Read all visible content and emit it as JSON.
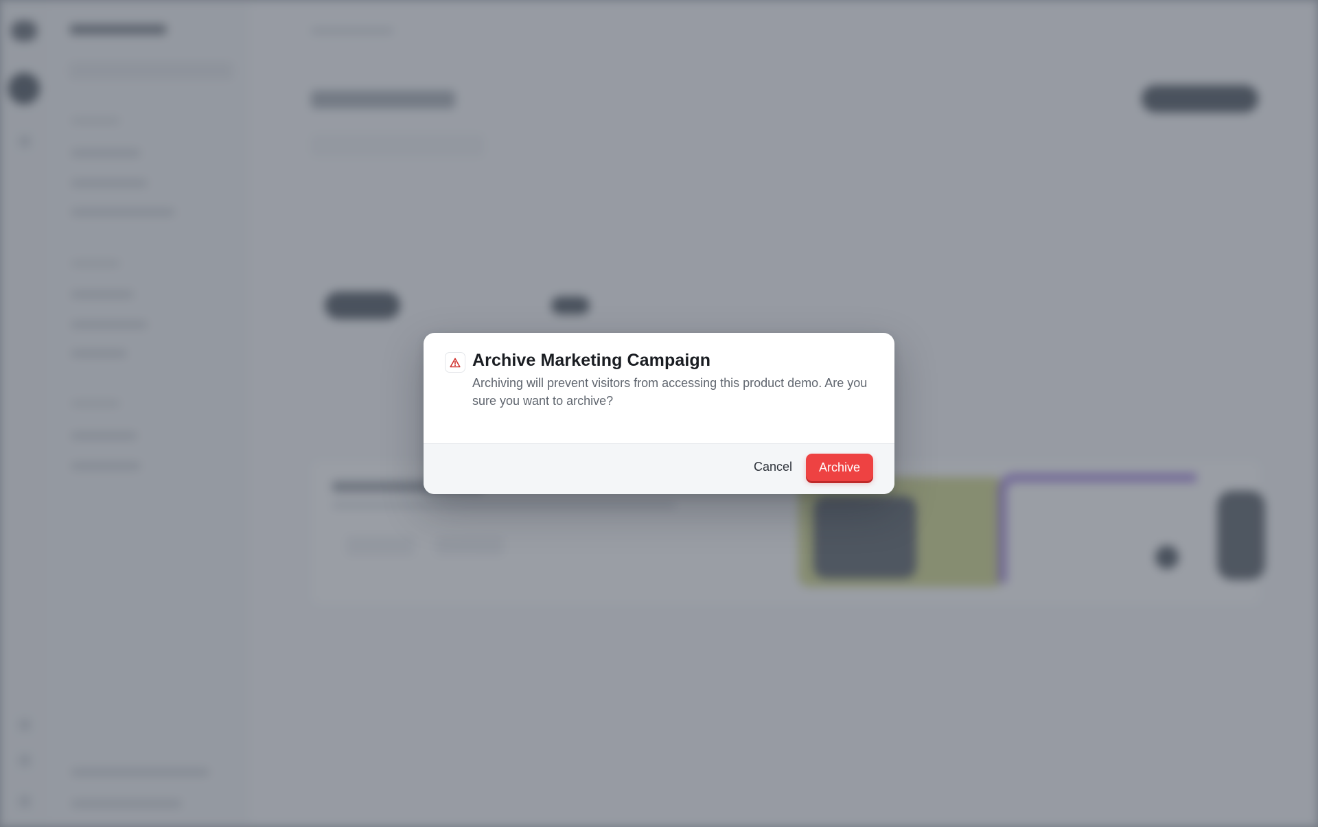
{
  "dialog": {
    "icon": "warning-triangle-icon",
    "title": "Archive Marketing Campaign",
    "description": "Archiving will prevent visitors from accessing this product demo. Are you sure you want to archive?",
    "cancel_label": "Cancel",
    "confirm_label": "Archive"
  },
  "colors": {
    "danger": "#ee4242",
    "icon_red": "#d0312d",
    "overlay": "#9097a0"
  }
}
